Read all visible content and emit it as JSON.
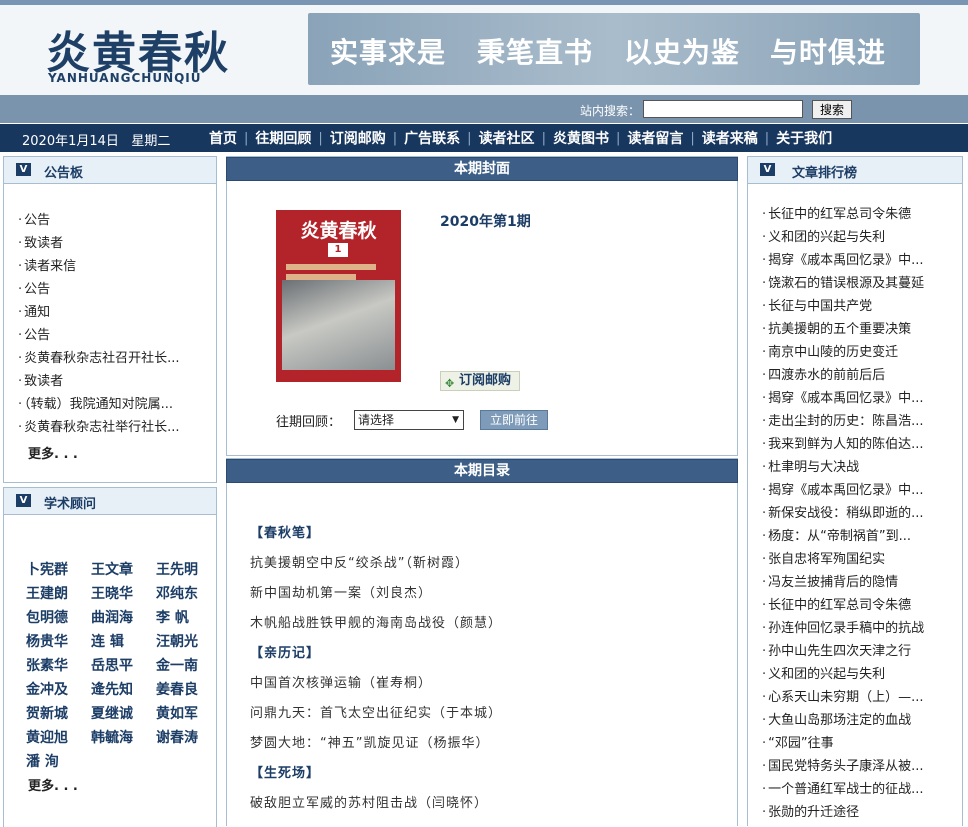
{
  "header": {
    "logo_cn": "炎黄春秋",
    "logo_en": "YANHUANGCHUNQIU",
    "banner_slogans": [
      "实事求是",
      "秉笔直书",
      "以史为鉴",
      "与时俱进"
    ]
  },
  "search": {
    "label": "站内搜索：",
    "placeholder": "",
    "button": "搜索"
  },
  "nav": {
    "date": "2020年1月14日",
    "weekday": "星期二",
    "items": [
      "首页",
      "往期回顾",
      "订阅邮购",
      "广告联系",
      "读者社区",
      "炎黄图书",
      "读者留言",
      "读者来稿",
      "关于我们"
    ]
  },
  "bulletin": {
    "title": "公告板",
    "items": [
      "公告",
      "致读者",
      "读者来信",
      "公告",
      "通知",
      "公告",
      "炎黄春秋杂志社召开社长...",
      "致读者",
      "（转载）我院通知对院属...",
      "炎黄春秋杂志社举行社长..."
    ],
    "more": "更多. . ."
  },
  "advisors": {
    "title": "学术顾问",
    "names": [
      "卜宪群",
      "王文章",
      "王先明",
      "王建朗",
      "王晓华",
      "邓纯东",
      "包明德",
      "曲润海",
      "李 帆",
      "杨贵华",
      "连 辑",
      "汪朝光",
      "张素华",
      "岳思平",
      "金一南",
      "金冲及",
      "逄先知",
      "姜春良",
      "贺新城",
      "夏继诚",
      "黄如军",
      "黄迎旭",
      "韩毓海",
      "谢春涛",
      "潘 洵"
    ],
    "more": "更多. . ."
  },
  "cover_section": {
    "title": "本期封面",
    "issue": "2020年第1期",
    "cover_title": "炎黄春秋",
    "cover_number": "1",
    "subscribe": "订阅邮购",
    "past_label": "往期回顾：",
    "select_value": "请选择",
    "go_button": "立即前往"
  },
  "toc": {
    "title": "本期目录",
    "lines": [
      {
        "text": "【春秋笔】",
        "section": true
      },
      {
        "text": "抗美援朝空中反“绞杀战”（靳树霞）",
        "section": false
      },
      {
        "text": "新中国劫机第一案（刘良杰）",
        "section": false
      },
      {
        "text": "木帆船战胜铁甲舰的海南岛战役（颜慧）",
        "section": false
      },
      {
        "text": "【亲历记】",
        "section": true
      },
      {
        "text": "中国首次核弹运输（崔寿桐）",
        "section": false
      },
      {
        "text": "问鼎九天：首飞太空出征纪实（于本城）",
        "section": false
      },
      {
        "text": "梦圆大地：“神五”凯旋见证（杨振华）",
        "section": false
      },
      {
        "text": "【生死场】",
        "section": true
      },
      {
        "text": "破敌胆立军威的苏村阻击战（闫晓怀）",
        "section": false
      }
    ]
  },
  "ranking": {
    "title": "文章排行榜",
    "items": [
      "长征中的红军总司令朱德",
      "义和团的兴起与失利",
      "揭穿《戚本禹回忆录》中...",
      "饶漱石的错误根源及其蔓延",
      "长征与中国共产党",
      "抗美援朝的五个重要决策",
      "南京中山陵的历史变迁",
      "四渡赤水的前前后后",
      "揭穿《戚本禹回忆录》中...",
      "走出尘封的历史：陈昌浩...",
      "我来到鲜为人知的陈伯达...",
      "杜聿明与大决战",
      "揭穿《戚本禹回忆录》中...",
      "新保安战役：稍纵即逝的...",
      "杨度：从“帝制祸首”到...",
      "张自忠将军殉国纪实",
      "冯友兰披捕背后的隐情",
      "长征中的红军总司令朱德",
      "孙连仲回忆录手稿中的抗战",
      "孙中山先生四次天津之行",
      "义和团的兴起与失利",
      "心系天山未穷期（上）—...",
      "大鱼山岛那场注定的血战",
      "“邓园”往事",
      "国民党特务头子康泽从被...",
      "一个普通红军战士的征战...",
      "张勋的升迁途径"
    ]
  }
}
